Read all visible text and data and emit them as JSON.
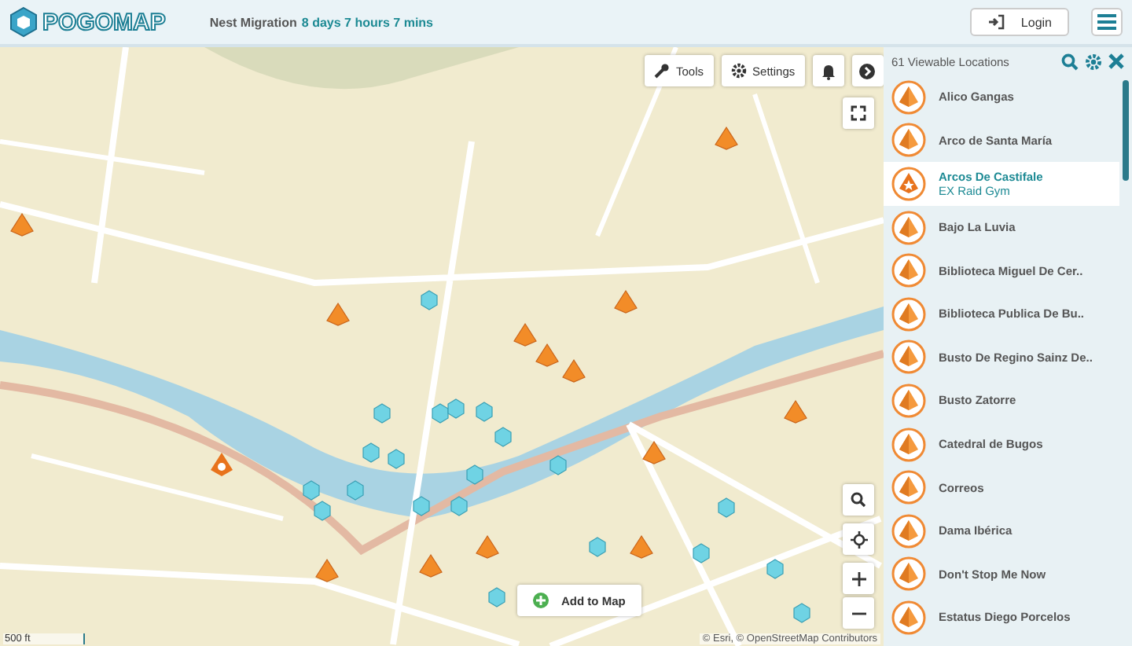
{
  "header": {
    "logo": "POGOMAP",
    "migration_label": "Nest Migration",
    "migration_time": "8 days 7 hours 7 mins",
    "login": "Login"
  },
  "map_toolbar": {
    "tools": "Tools",
    "settings": "Settings"
  },
  "map": {
    "add_button": "Add to Map",
    "scale": "500 ft",
    "attribution": "© Esri, © OpenStreetMap Contributors"
  },
  "sidebar": {
    "count_label": "61 Viewable Locations",
    "items": [
      {
        "name": "Alico Gangas",
        "kind": "stop",
        "selected": false
      },
      {
        "name": "Arco de Santa María",
        "kind": "stop",
        "selected": false
      },
      {
        "name": "Arcos De Castifale",
        "subtitle": "EX Raid Gym",
        "kind": "gym",
        "selected": true
      },
      {
        "name": "Bajo La Luvia",
        "kind": "stop",
        "selected": false
      },
      {
        "name": "Biblioteca Miguel De Cer..",
        "kind": "stop",
        "selected": false
      },
      {
        "name": "Biblioteca Publica De Bu..",
        "kind": "stop",
        "selected": false
      },
      {
        "name": "Busto De Regino Sainz De..",
        "kind": "stop",
        "selected": false
      },
      {
        "name": "Busto Zatorre",
        "kind": "stop",
        "selected": false
      },
      {
        "name": "Catedral de Bugos",
        "kind": "stop",
        "selected": false
      },
      {
        "name": "Correos",
        "kind": "stop",
        "selected": false
      },
      {
        "name": "Dama Ibérica",
        "kind": "stop",
        "selected": false
      },
      {
        "name": "Don't Stop Me Now",
        "kind": "stop",
        "selected": false
      },
      {
        "name": "Estatus Diego Porcelos",
        "kind": "stop",
        "selected": false
      }
    ]
  }
}
